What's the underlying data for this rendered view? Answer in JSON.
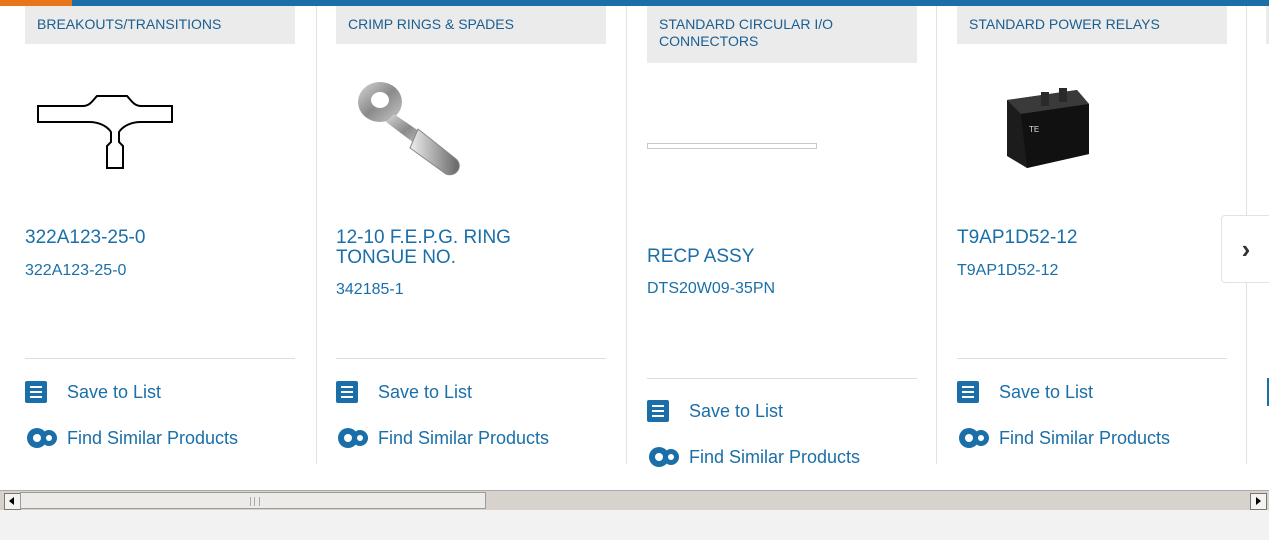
{
  "cards": [
    {
      "category": "BREAKOUTS/TRANSITIONS",
      "title": "322A123-25-0",
      "part_number": "322A123-25-0",
      "image_icon": "breakout-transition-icon",
      "save_label": "Save to List",
      "similar_label": "Find Similar Products"
    },
    {
      "category": "CRIMP RINGS & SPADES",
      "title": "12-10 F.E.P.G. RING TONGUE NO.",
      "part_number": "342185-1",
      "image_icon": "ring-terminal-icon",
      "save_label": "Save to List",
      "similar_label": "Find Similar Products"
    },
    {
      "category": "STANDARD CIRCULAR I/O CONNECTORS",
      "title": "RECP ASSY",
      "part_number": "DTS20W09-35PN",
      "image_icon": "connector-placeholder-icon",
      "save_label": "Save to List",
      "similar_label": "Find Similar Products"
    },
    {
      "category": "STANDARD POWER RELAYS",
      "title": "T9AP1D52-12",
      "part_number": "T9AP1D52-12",
      "image_icon": "power-relay-icon",
      "save_label": "Save to List",
      "similar_label": "Find Similar Products"
    }
  ],
  "next_button": "›",
  "colors": {
    "link": "#1a6fa8",
    "top_bar": "#1a6fa8",
    "top_accent": "#e8751a",
    "category_bg": "#ebebeb"
  }
}
